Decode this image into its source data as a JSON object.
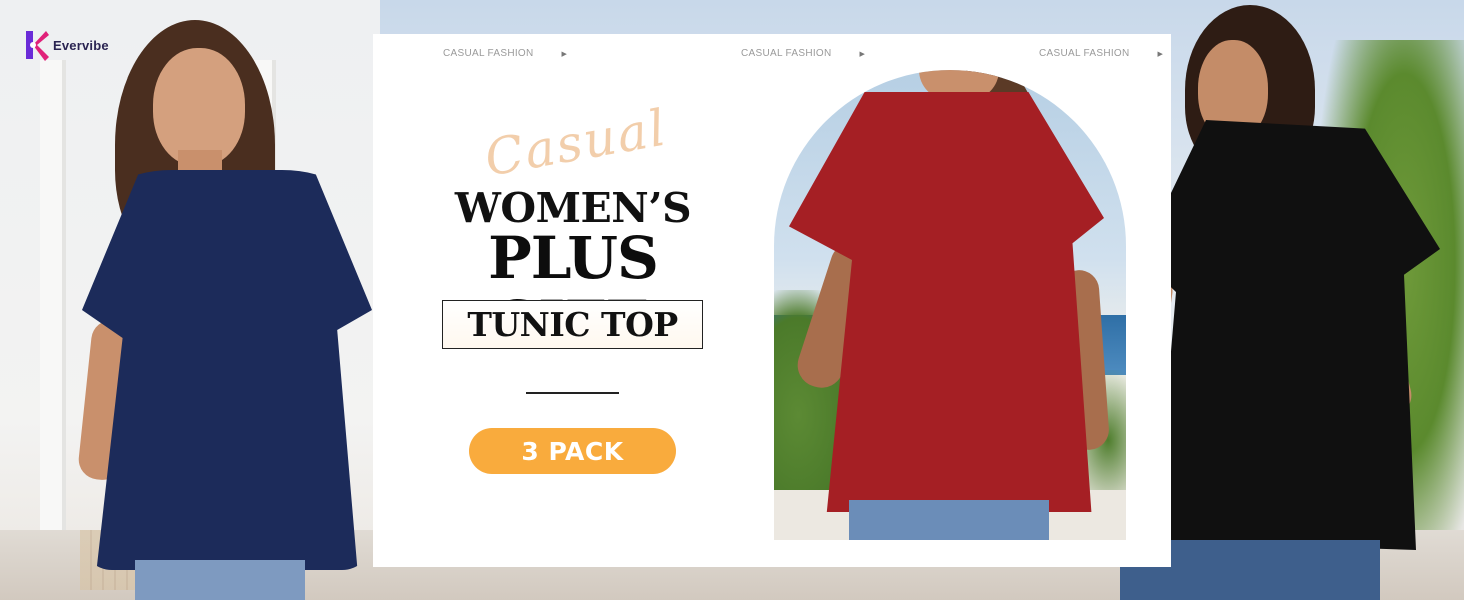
{
  "brand": {
    "name": "Evervibe",
    "colors": {
      "mark_primary": "#e0217a",
      "mark_secondary": "#6a2bd8",
      "text": "#2a2452"
    }
  },
  "ticker": {
    "items": [
      "CASUAL FASHION",
      "CASUAL FASHION",
      "CASUAL FASHION"
    ],
    "arrow_icon": "play-triangle-icon"
  },
  "headline": {
    "script": "Casual",
    "line1": "WOMEN’S",
    "line2": "PLUS SIZE",
    "line3": "TUNIC TOP"
  },
  "cta": {
    "label": "3 PACK",
    "color": "#f9ab3d"
  },
  "products": {
    "colors": [
      "#1c2b5a",
      "#a51f24",
      "#101010"
    ],
    "color_names": [
      "navy",
      "red",
      "black"
    ]
  }
}
